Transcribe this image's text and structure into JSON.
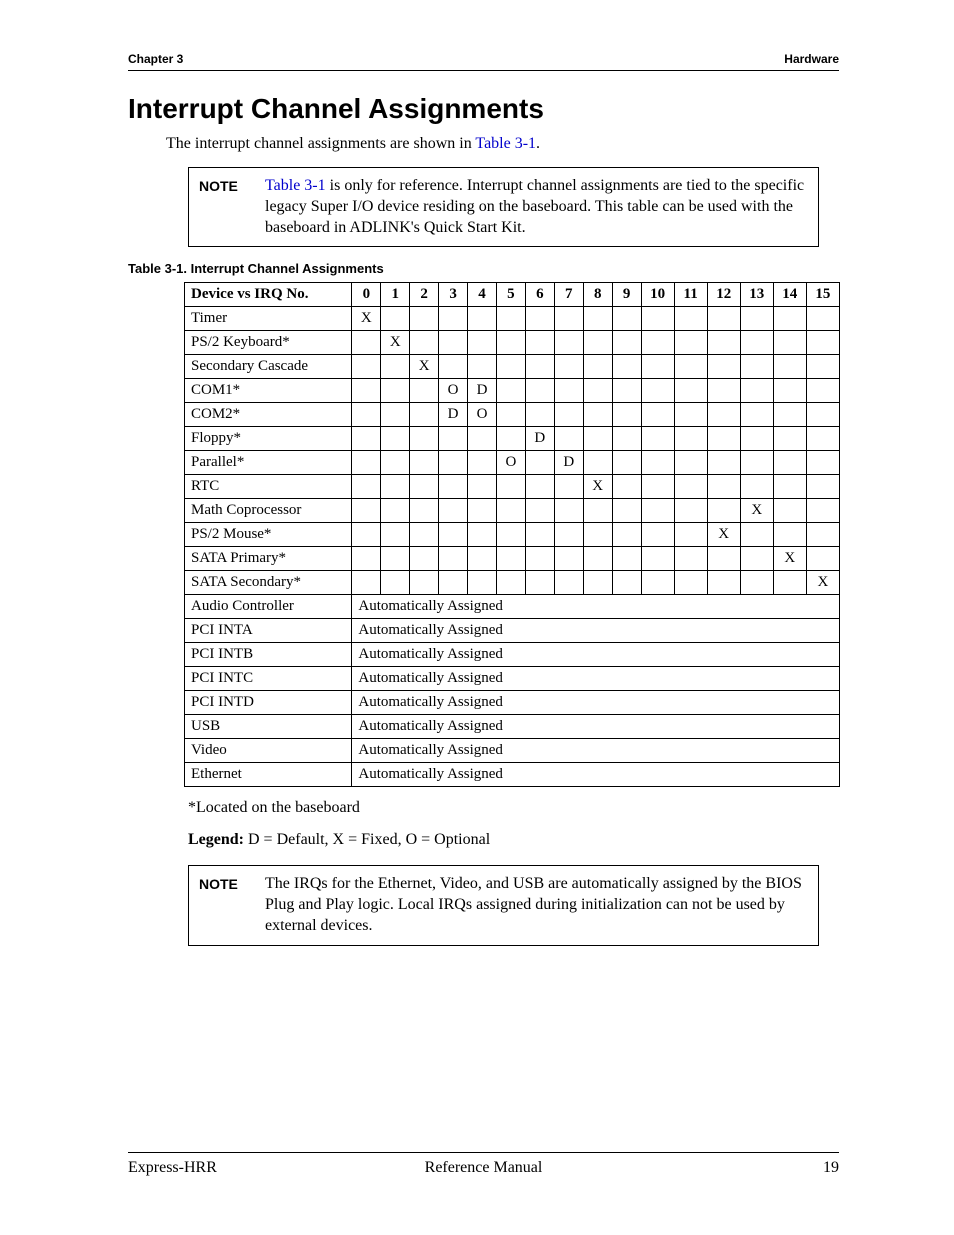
{
  "header": {
    "left": "Chapter 3",
    "right": "Hardware"
  },
  "section_title": "Interrupt Channel Assignments",
  "intro": {
    "pre": "The interrupt channel assignments are shown in ",
    "link": "Table 3-1",
    "post": "."
  },
  "note1": {
    "label": "NOTE",
    "link": "Table 3-1",
    "text": " is only for reference. Interrupt channel assignments are tied to the specific legacy Super I/O device residing on the baseboard. This table can be used with the baseboard in ADLINK's Quick Start Kit."
  },
  "table": {
    "caption": "Table 3-1.   Interrupt Channel Assignments",
    "header_first": "Device vs IRQ No.",
    "irq_cols": [
      "0",
      "1",
      "2",
      "3",
      "4",
      "5",
      "6",
      "7",
      "8",
      "9",
      "10",
      "11",
      "12",
      "13",
      "14",
      "15"
    ],
    "rows": [
      {
        "device": "Timer",
        "cells": [
          "X",
          "",
          "",
          "",
          "",
          "",
          "",
          "",
          "",
          "",
          "",
          "",
          "",
          "",
          "",
          ""
        ]
      },
      {
        "device": "PS/2 Keyboard*",
        "cells": [
          "",
          "X",
          "",
          "",
          "",
          "",
          "",
          "",
          "",
          "",
          "",
          "",
          "",
          "",
          "",
          ""
        ]
      },
      {
        "device": "Secondary Cascade",
        "cells": [
          "",
          "",
          "X",
          "",
          "",
          "",
          "",
          "",
          "",
          "",
          "",
          "",
          "",
          "",
          "",
          ""
        ]
      },
      {
        "device": "COM1*",
        "cells": [
          "",
          "",
          "",
          "O",
          "D",
          "",
          "",
          "",
          "",
          "",
          "",
          "",
          "",
          "",
          "",
          ""
        ]
      },
      {
        "device": "COM2*",
        "cells": [
          "",
          "",
          "",
          "D",
          "O",
          "",
          "",
          "",
          "",
          "",
          "",
          "",
          "",
          "",
          "",
          ""
        ]
      },
      {
        "device": "Floppy*",
        "cells": [
          "",
          "",
          "",
          "",
          "",
          "",
          "D",
          "",
          "",
          "",
          "",
          "",
          "",
          "",
          "",
          ""
        ]
      },
      {
        "device": "Parallel*",
        "cells": [
          "",
          "",
          "",
          "",
          "",
          "O",
          "",
          "D",
          "",
          "",
          "",
          "",
          "",
          "",
          "",
          ""
        ]
      },
      {
        "device": "RTC",
        "cells": [
          "",
          "",
          "",
          "",
          "",
          "",
          "",
          "",
          "X",
          "",
          "",
          "",
          "",
          "",
          "",
          ""
        ]
      },
      {
        "device": "Math Coprocessor",
        "cells": [
          "",
          "",
          "",
          "",
          "",
          "",
          "",
          "",
          "",
          "",
          "",
          "",
          "",
          "X",
          "",
          ""
        ]
      },
      {
        "device": "PS/2 Mouse*",
        "cells": [
          "",
          "",
          "",
          "",
          "",
          "",
          "",
          "",
          "",
          "",
          "",
          "",
          "X",
          "",
          "",
          ""
        ]
      },
      {
        "device": "SATA Primary*",
        "cells": [
          "",
          "",
          "",
          "",
          "",
          "",
          "",
          "",
          "",
          "",
          "",
          "",
          "",
          "",
          "X",
          ""
        ]
      },
      {
        "device": "SATA Secondary*",
        "cells": [
          "",
          "",
          "",
          "",
          "",
          "",
          "",
          "",
          "",
          "",
          "",
          "",
          "",
          "",
          "",
          "X"
        ]
      }
    ],
    "auto_rows": [
      {
        "device": "Audio Controller",
        "text": "Automatically Assigned"
      },
      {
        "device": "PCI INTA",
        "text": "Automatically Assigned"
      },
      {
        "device": "PCI INTB",
        "text": "Automatically Assigned"
      },
      {
        "device": "PCI INTC",
        "text": "Automatically Assigned"
      },
      {
        "device": "PCI INTD",
        "text": "Automatically Assigned"
      },
      {
        "device": "USB",
        "text": "Automatically Assigned"
      },
      {
        "device": "Video",
        "text": "Automatically Assigned"
      },
      {
        "device": "Ethernet",
        "text": "Automatically Assigned"
      }
    ]
  },
  "footnote": "*Located on the baseboard",
  "legend": {
    "label": "Legend:",
    "text": " D = Default, X = Fixed, O = Optional"
  },
  "note2": {
    "label": "NOTE",
    "text": "The IRQs for the Ethernet, Video, and USB are automatically assigned by the BIOS Plug and Play logic. Local IRQs assigned during initialization can not be used by external devices."
  },
  "footer": {
    "left": "Express-HRR",
    "center": "Reference Manual",
    "right": "19"
  }
}
